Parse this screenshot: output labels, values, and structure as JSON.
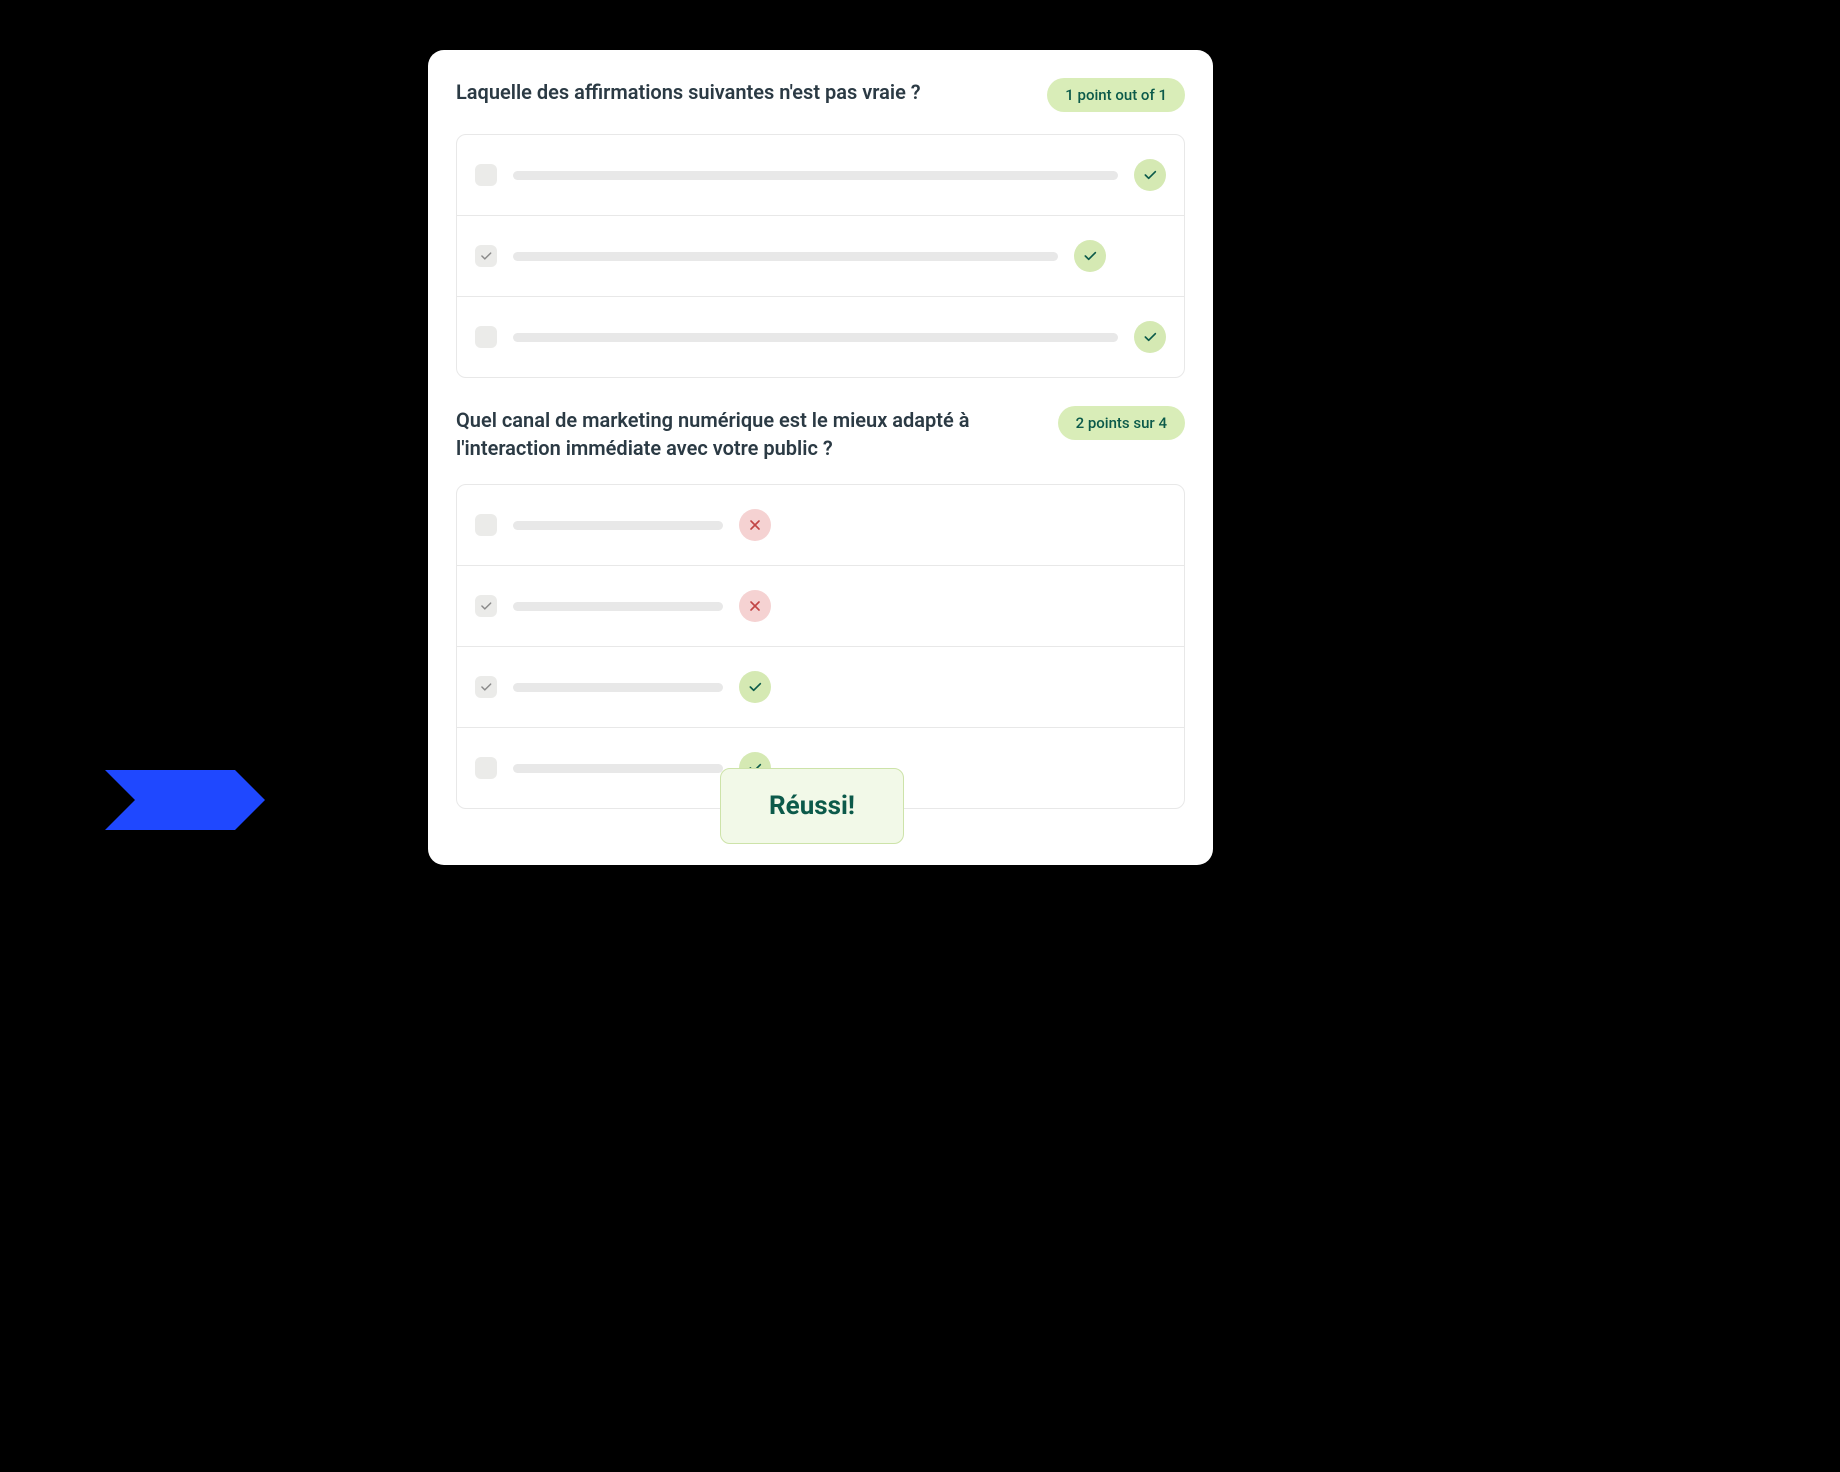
{
  "questions": [
    {
      "text": "Laquelle des affirmations suivantes n'est pas vraie ?",
      "score": "1 point out of 1",
      "options": [
        {
          "checked": false,
          "length": "long",
          "status": "ok"
        },
        {
          "checked": true,
          "length": "medium",
          "status": "ok"
        },
        {
          "checked": false,
          "length": "long",
          "status": "ok"
        }
      ]
    },
    {
      "text": "Quel canal de marketing numérique est le mieux adapté  à l'interaction immédiate avec votre public ?",
      "score": "2 points sur 4",
      "options": [
        {
          "checked": false,
          "length": "short",
          "status": "bad"
        },
        {
          "checked": true,
          "length": "short",
          "status": "bad"
        },
        {
          "checked": true,
          "length": "short",
          "status": "ok"
        },
        {
          "checked": false,
          "length": "short",
          "status": "ok"
        }
      ]
    }
  ],
  "passBadge": "Réussi!"
}
